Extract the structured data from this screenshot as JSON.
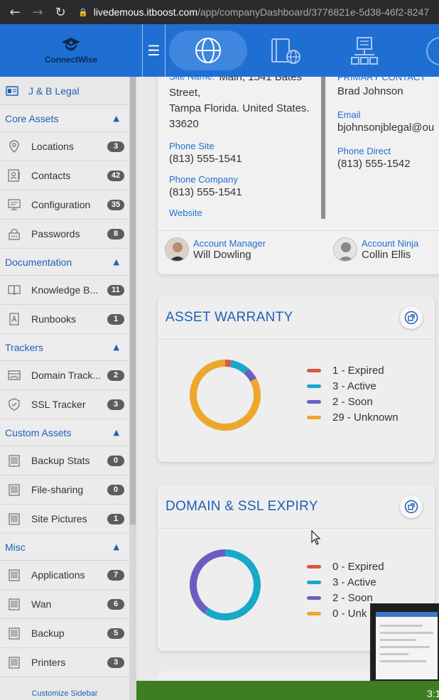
{
  "browser": {
    "url_host": "livedemous.itboost.com",
    "url_path": "/app/companyDashboard/3776821e-5d38-46f2-8247"
  },
  "header": {
    "logo_text": "ConnectWise"
  },
  "sidebar": {
    "company": "J & B Legal",
    "sections": [
      {
        "title": "Core Assets",
        "items": [
          {
            "label": "Locations",
            "count": "3",
            "icon": "map-pin-icon"
          },
          {
            "label": "Contacts",
            "count": "42",
            "icon": "contact-card-icon"
          },
          {
            "label": "Configuration",
            "count": "35",
            "icon": "monitor-icon"
          },
          {
            "label": "Passwords",
            "count": "8",
            "icon": "lock-icon"
          }
        ]
      },
      {
        "title": "Documentation",
        "items": [
          {
            "label": "Knowledge B...",
            "count": "11",
            "icon": "book-icon"
          },
          {
            "label": "Runbooks",
            "count": "1",
            "icon": "runbook-icon"
          }
        ]
      },
      {
        "title": "Trackers",
        "items": [
          {
            "label": "Domain Track...",
            "count": "2",
            "icon": "domain-icon"
          },
          {
            "label": "SSL Tracker",
            "count": "3",
            "icon": "shield-check-icon"
          }
        ]
      },
      {
        "title": "Custom Assets",
        "items": [
          {
            "label": "Backup Stats",
            "count": "0",
            "icon": "building-icon"
          },
          {
            "label": "File-sharing",
            "count": "0",
            "icon": "building-icon"
          },
          {
            "label": "Site Pictures",
            "count": "1",
            "icon": "building-icon"
          }
        ]
      },
      {
        "title": "Misc",
        "items": [
          {
            "label": "Applications",
            "count": "7",
            "icon": "building-icon"
          },
          {
            "label": "Wan",
            "count": "6",
            "icon": "building-icon"
          },
          {
            "label": "Backup",
            "count": "5",
            "icon": "building-icon"
          },
          {
            "label": "Printers",
            "count": "3",
            "icon": "building-icon"
          }
        ]
      }
    ],
    "customize_link": "Customize Sidebar"
  },
  "contact_card": {
    "site_name_label": "Site Name:",
    "address_lines": [
      "Main, 1541 Bates",
      "Street,",
      "Tampa Florida. United States.",
      "33620"
    ],
    "phone_site_label": "Phone Site",
    "phone_site": "(813) 555-1541",
    "phone_company_label": "Phone Company",
    "phone_company": "(813) 555-1541",
    "website_label": "Website",
    "primary_contact_label": "PRIMARY CONTACT",
    "primary_contact": "Brad Johnson",
    "email_label": "Email",
    "email": "bjohnsonjblegal@ou",
    "phone_direct_label": "Phone Direct",
    "phone_direct": "(813) 555-1542",
    "account_manager_label": "Account Manager",
    "account_manager": "Will Dowling",
    "account_ninja_label": "Account Ninja",
    "account_ninja": "Collin Ellis"
  },
  "asset_warranty": {
    "title": "ASSET WARRANTY",
    "legend": [
      {
        "label": "1 - Expired",
        "color": "#d9573f",
        "value": 1
      },
      {
        "label": "3 - Active",
        "color": "#17a9c9",
        "value": 3
      },
      {
        "label": "2 - Soon",
        "color": "#6a5fc1",
        "value": 2
      },
      {
        "label": "29 - Unknown",
        "color": "#eda72c",
        "value": 29
      }
    ]
  },
  "domain_ssl": {
    "title": "DOMAIN & SSL EXPIRY",
    "legend": [
      {
        "label": "0 - Expired",
        "color": "#d9573f",
        "value": 0
      },
      {
        "label": "3 - Active",
        "color": "#17a9c9",
        "value": 3
      },
      {
        "label": "2 - Soon",
        "color": "#6a5fc1",
        "value": 2
      },
      {
        "label": "0 - Unk",
        "color": "#eda72c",
        "value": 0
      }
    ]
  },
  "overlay": {
    "time_text": "3:1"
  }
}
